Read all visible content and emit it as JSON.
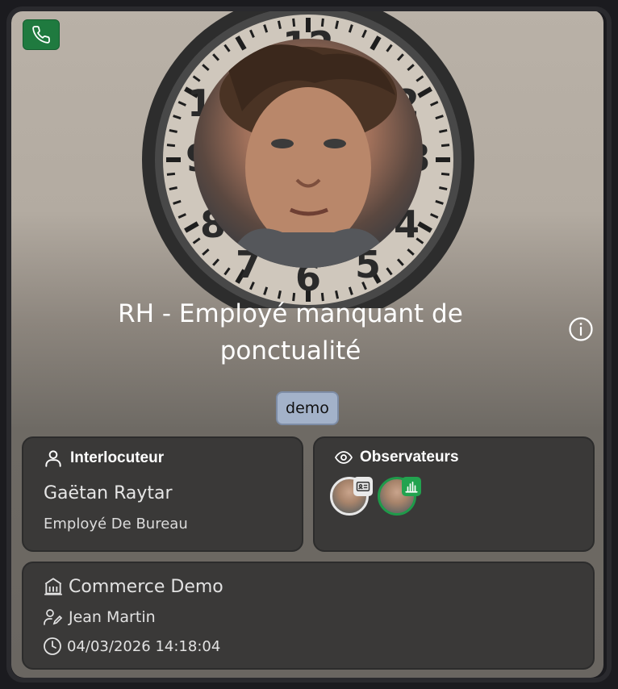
{
  "header": {
    "title": "RH - Employé manquant de ponctualité",
    "tag": "demo",
    "call_button_icon": "phone-icon",
    "info_button_icon": "info-icon"
  },
  "interlocutor": {
    "heading": "Interlocuteur",
    "name": "Gaëtan Raytar",
    "role": "Employé De Bureau"
  },
  "observers": {
    "heading": "Observateurs",
    "items": [
      {
        "badge_icon": "id-card-icon",
        "ring_color": "#e8e8e8"
      },
      {
        "badge_icon": "bar-chart-icon",
        "ring_color": "#1f9a4a"
      }
    ]
  },
  "details": {
    "company": "Commerce Demo",
    "owner": "Jean Martin",
    "datetime": "04/03/2026 14:18:04"
  },
  "colors": {
    "accent_green": "#1f7a3f",
    "tag_bg": "#a3b2c9",
    "panel_bg": "#3a3938"
  }
}
